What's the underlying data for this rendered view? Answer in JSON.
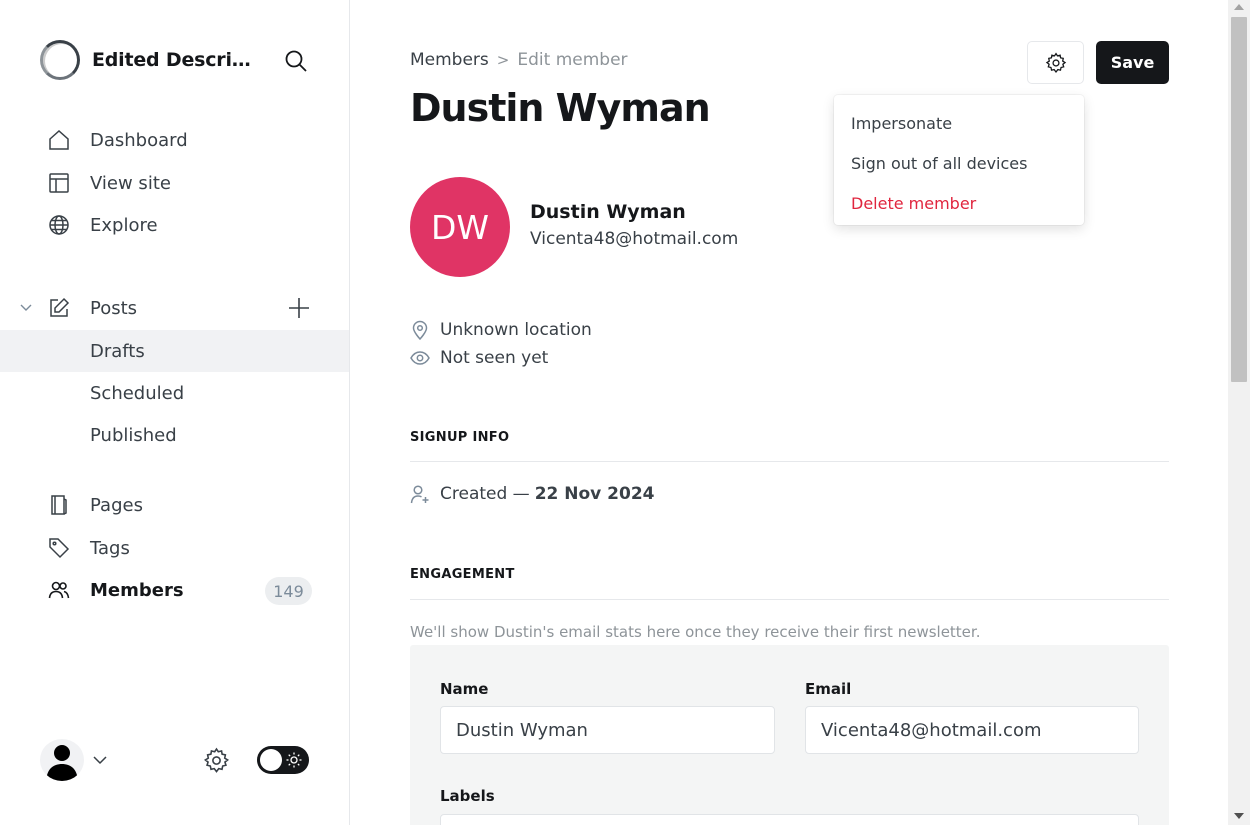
{
  "sidebar": {
    "site_title": "Edited Descripti...",
    "nav": {
      "dashboard": "Dashboard",
      "view_site": "View site",
      "explore": "Explore",
      "posts": "Posts",
      "drafts": "Drafts",
      "scheduled": "Scheduled",
      "published": "Published",
      "pages": "Pages",
      "tags": "Tags",
      "members": "Members",
      "members_count": "149"
    }
  },
  "breadcrumb": {
    "parent": "Members",
    "separator": ">",
    "current": "Edit member"
  },
  "header": {
    "title": "Dustin Wyman",
    "save_label": "Save"
  },
  "dropdown": {
    "items": [
      "Impersonate",
      "Sign out of all devices",
      "Delete member"
    ]
  },
  "member": {
    "initials": "DW",
    "name": "Dustin Wyman",
    "email": "Vicenta48@hotmail.com",
    "location": "Unknown location",
    "last_seen": "Not seen yet"
  },
  "signup": {
    "heading": "SIGNUP INFO",
    "created_prefix": "Created —",
    "created_date": "22 Nov 2024"
  },
  "engagement": {
    "heading": "ENGAGEMENT",
    "note": "We'll show Dustin's email stats here once they receive their first newsletter."
  },
  "form": {
    "name_label": "Name",
    "name_value": "Dustin Wyman",
    "email_label": "Email",
    "email_value": "Vicenta48@hotmail.com",
    "labels_label": "Labels"
  },
  "colors": {
    "avatar_bg": "#e03465",
    "danger": "#e0253e",
    "primary_button": "#15171a"
  }
}
